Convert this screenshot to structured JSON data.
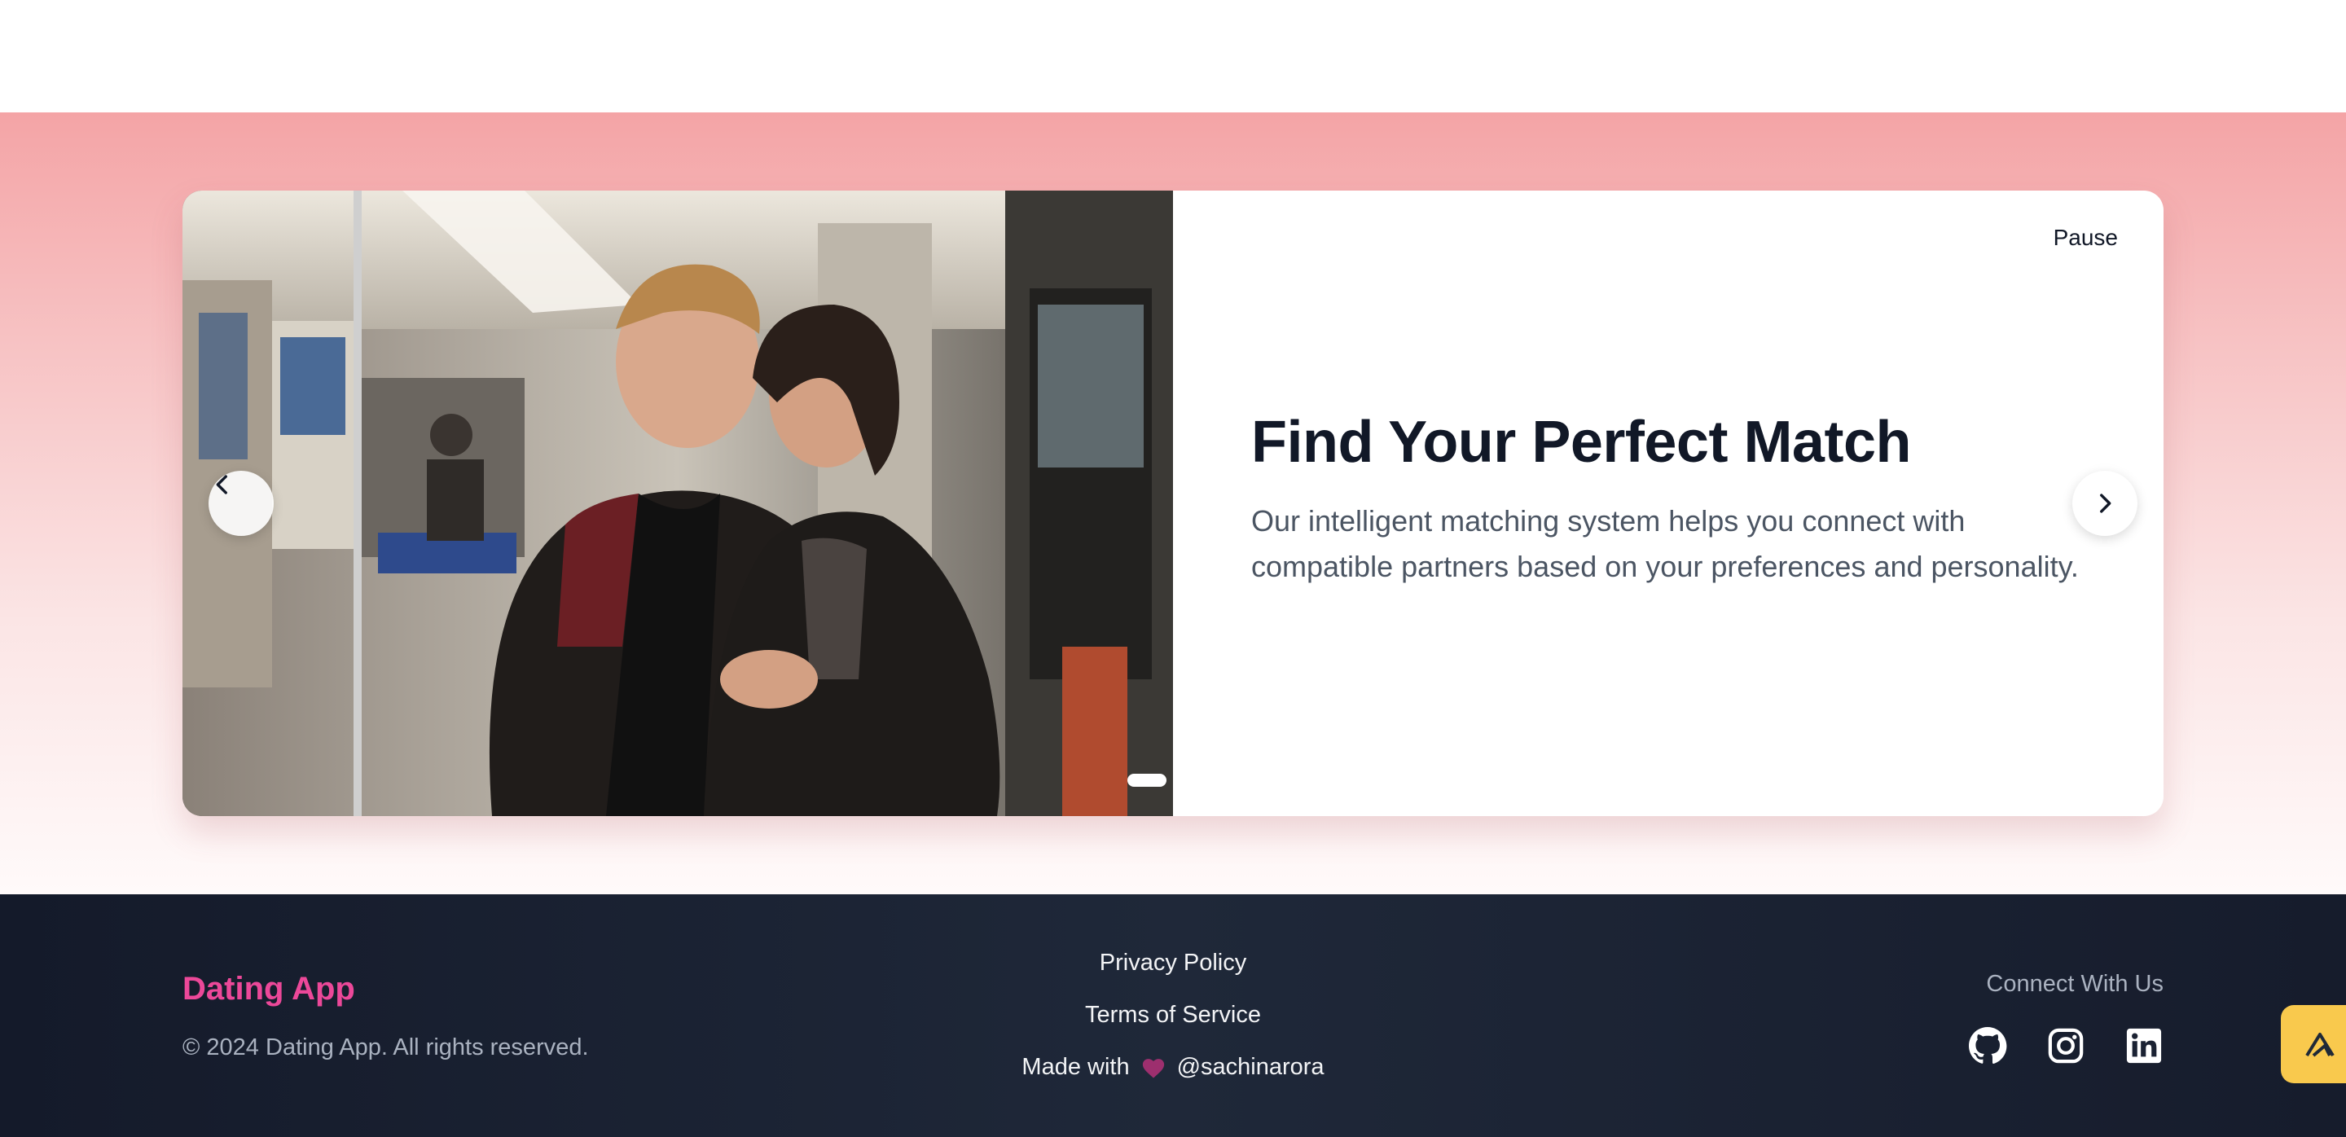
{
  "carousel": {
    "pause_label": "Pause",
    "slide": {
      "title": "Find Your Perfect Match",
      "description": "Our intelligent matching system helps you connect with compatible partners based on your preferences and personality."
    },
    "active_slide": 1,
    "prev_icon": "chevron-left-icon",
    "next_icon": "chevron-right-icon"
  },
  "footer": {
    "brand": "Dating App",
    "copyright": "© 2024 Dating App. All rights reserved.",
    "links": {
      "privacy": "Privacy Policy",
      "terms": "Terms of Service"
    },
    "made_with": {
      "prefix": "Made with",
      "icon": "heart-icon",
      "handle": "@sachinarora"
    },
    "connect_heading": "Connect With Us",
    "socials": [
      "github-icon",
      "instagram-icon",
      "linkedin-icon"
    ]
  },
  "colors": {
    "brand": "#ec4899",
    "heart": "#9d2f6e",
    "footer_bg": "#1b2233",
    "fab": "#f9c94d"
  }
}
